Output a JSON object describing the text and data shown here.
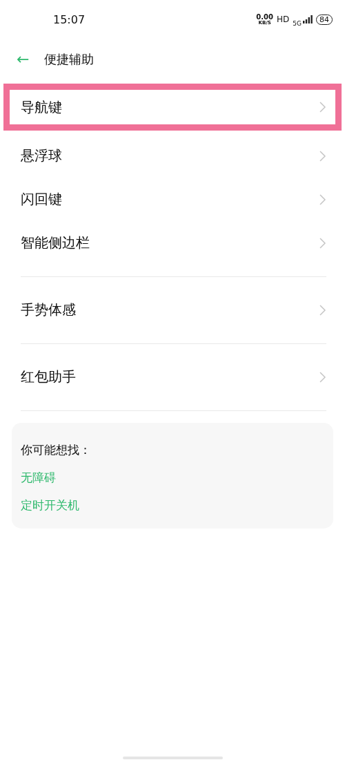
{
  "status_bar": {
    "time": "15:07",
    "speed": "0.00",
    "speed_unit": "KB/S",
    "hd": "HD",
    "network": "5G",
    "battery": "84"
  },
  "header": {
    "back": "←",
    "title": "便捷辅助"
  },
  "groups": [
    {
      "items": [
        {
          "label": "导航键",
          "highlighted": true
        },
        {
          "label": "悬浮球",
          "highlighted": false
        },
        {
          "label": "闪回键",
          "highlighted": false
        },
        {
          "label": "智能侧边栏",
          "highlighted": false
        }
      ]
    },
    {
      "items": [
        {
          "label": "手势体感",
          "highlighted": false
        }
      ]
    },
    {
      "items": [
        {
          "label": "红包助手",
          "highlighted": false
        }
      ]
    }
  ],
  "suggestions": {
    "title": "你可能想找：",
    "links": [
      "无障碍",
      "定时开关机"
    ]
  }
}
